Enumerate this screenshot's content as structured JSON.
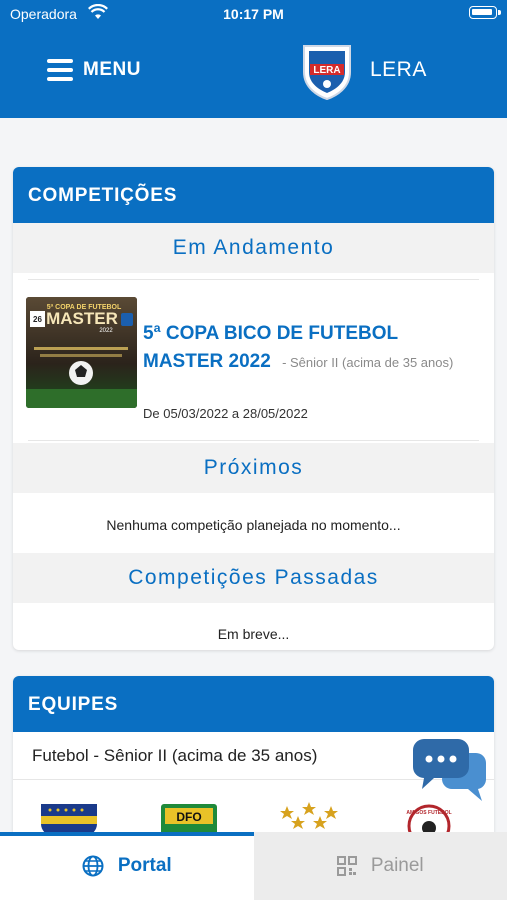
{
  "status_bar": {
    "carrier": "Operadora",
    "time": "10:17 PM"
  },
  "header": {
    "menu_label": "MENU",
    "brand": "LERA",
    "logo_text": "LERA"
  },
  "competitions": {
    "heading": "COMPETIÇÕES",
    "in_progress": {
      "title": "Em Andamento",
      "items": [
        {
          "name": "5ª COPA BICO DE FUTEBOL MASTER 2022",
          "category": "- Sênior II (acima de 35 anos)",
          "dates": "De 05/03/2022 a 28/05/2022",
          "poster_text": [
            "5ª COPA DE FUTEBOL",
            "MASTER",
            "2022",
            "26"
          ]
        }
      ]
    },
    "upcoming": {
      "title": "Próximos",
      "message": "Nenhuma competição planejada no momento..."
    },
    "past": {
      "title": "Competições Passadas",
      "message": "Em breve..."
    }
  },
  "teams": {
    "heading": "EQUIPES",
    "category": "Futebol - Sênior II (acima de 35 anos)",
    "badges": [
      {
        "name": "team-1",
        "color": "#1a3a8a"
      },
      {
        "name": "team-2",
        "color": "#1f8a3a",
        "label": "DFO"
      },
      {
        "name": "team-3",
        "color": "#d7a21e"
      },
      {
        "name": "team-4",
        "color": "#b2262c",
        "label": "AMIGOS FUTEBOL"
      }
    ]
  },
  "tabbar": {
    "tabs": [
      {
        "label": "Portal",
        "icon": "globe-icon",
        "active": true
      },
      {
        "label": "Painel",
        "icon": "grid-icon",
        "active": false
      }
    ]
  },
  "colors": {
    "primary": "#0a6fc2",
    "section_bg": "#f2f2f2",
    "page_bg": "#f4f5f7"
  }
}
